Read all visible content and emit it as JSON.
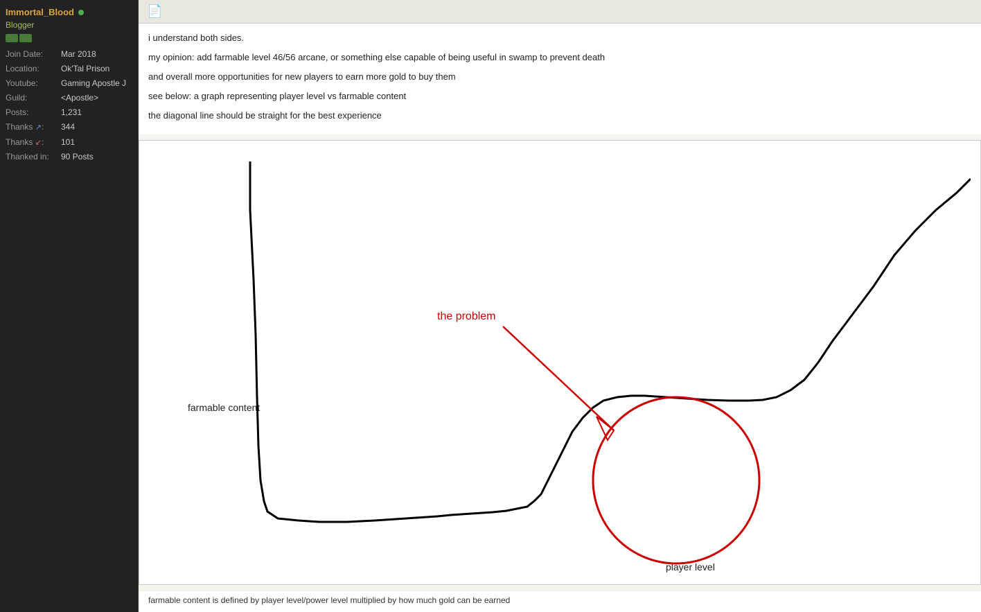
{
  "sidebar": {
    "username": "Immortal_Blood",
    "online": true,
    "role": "Blogger",
    "join_date_label": "Join Date:",
    "join_date_value": "Mar 2018",
    "location_label": "Location:",
    "location_value": "Ok'Tal Prison",
    "youtube_label": "Youtube:",
    "youtube_value": "Gaming Apostle J",
    "guild_label": "Guild:",
    "guild_value": "<Apostle>",
    "posts_label": "Posts:",
    "posts_value": "1,231",
    "thanks_up_label": "Thanks",
    "thanks_up_value": "344",
    "thanks_down_label": "Thanks",
    "thanks_down_value": "101",
    "thanked_in_label": "Thanked in:",
    "thanked_in_value": "90 Posts"
  },
  "post": {
    "line1": "i understand both sides.",
    "line2": "my opinion: add farmable level 46/56 arcane, or something else capable of being useful in swamp to prevent death",
    "line3": "and overall more opportunities for new players to earn more gold to buy them",
    "line4": "see below: a graph representing player level vs farmable content",
    "line5": "the diagonal line should be straight for the best experience",
    "chart_label_y": "farmable content",
    "chart_label_x": "player level",
    "chart_annotation": "the problem",
    "chart_caption": "farmable content is defined by player level/power level multiplied by how much gold can be earned"
  }
}
